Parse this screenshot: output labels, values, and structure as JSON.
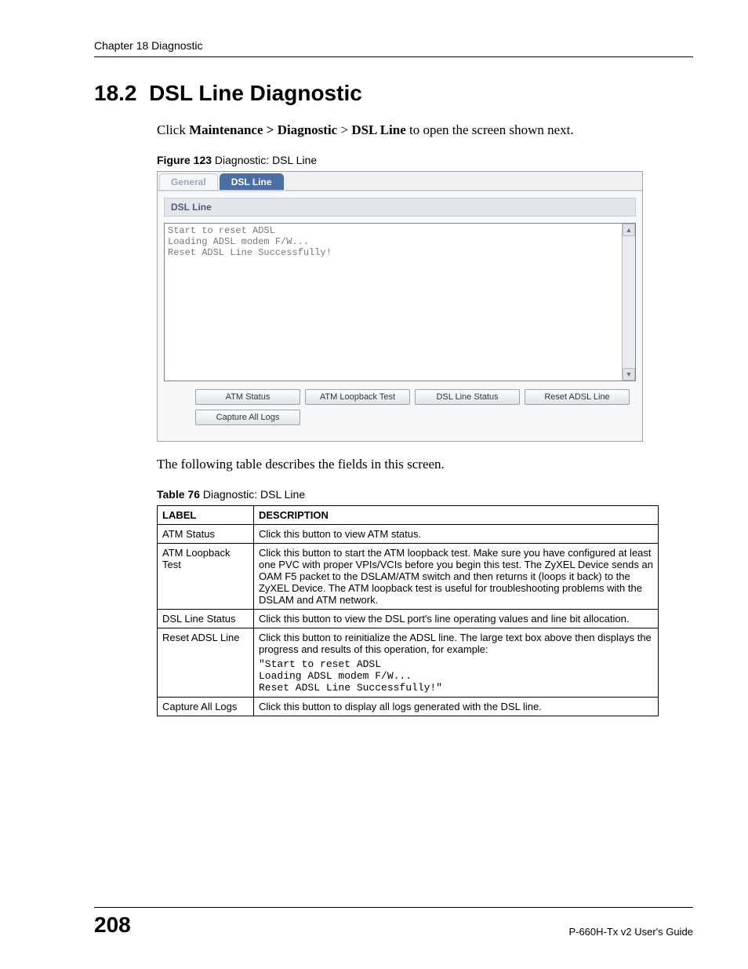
{
  "header": {
    "chapter": "Chapter 18 Diagnostic"
  },
  "section": {
    "number": "18.2",
    "title": "DSL Line Diagnostic"
  },
  "intro": {
    "pre": "Click ",
    "bold1": "Maintenance > Diagnostic",
    "mid": " > ",
    "bold2": "DSL Line",
    "post": " to open the screen shown next."
  },
  "figure_caption": {
    "label": "Figure 123",
    "text": "   Diagnostic: DSL Line"
  },
  "figure": {
    "tabs": {
      "general": "General",
      "dsl": "DSL Line"
    },
    "panel_title": "DSL Line",
    "log": "Start to reset ADSL\nLoading ADSL modem F/W...\nReset ADSL Line Successfully!",
    "buttons": {
      "atm_status": "ATM Status",
      "atm_loopback": "ATM Loopback Test",
      "dsl_status": "DSL Line Status",
      "reset_adsl": "Reset ADSL Line",
      "capture_logs": "Capture All Logs"
    }
  },
  "after_figure": "The following table describes the fields in this screen.",
  "table_caption": {
    "label": "Table 76",
    "text": "   Diagnostic: DSL Line"
  },
  "table": {
    "headers": {
      "label": "LABEL",
      "desc": "DESCRIPTION"
    },
    "rows": [
      {
        "label": "ATM Status",
        "desc": "Click this button to view ATM status."
      },
      {
        "label": "ATM Loopback Test",
        "desc": "Click this button to start the ATM loopback test. Make sure you have configured at least one PVC with proper VPIs/VCIs before you begin this test. The ZyXEL Device sends an OAM F5 packet to the DSLAM/ATM switch and then returns it (loops it back) to the ZyXEL Device. The ATM loopback test is useful for troubleshooting problems with the DSLAM and ATM network."
      },
      {
        "label": "DSL Line Status",
        "desc": "Click this button to view the DSL port's line operating values and line bit allocation."
      },
      {
        "label": "Reset ADSL Line",
        "desc": "Click this button to reinitialize the ADSL line. The large text box above then displays the progress and results of this operation, for example:",
        "mono": "\"Start to reset ADSL\nLoading ADSL modem F/W...\nReset ADSL Line Successfully!\""
      },
      {
        "label": "Capture All Logs",
        "desc": "Click this button to display all logs generated with the DSL line."
      }
    ]
  },
  "footer": {
    "page": "208",
    "guide": "P-660H-Tx v2 User's Guide"
  }
}
